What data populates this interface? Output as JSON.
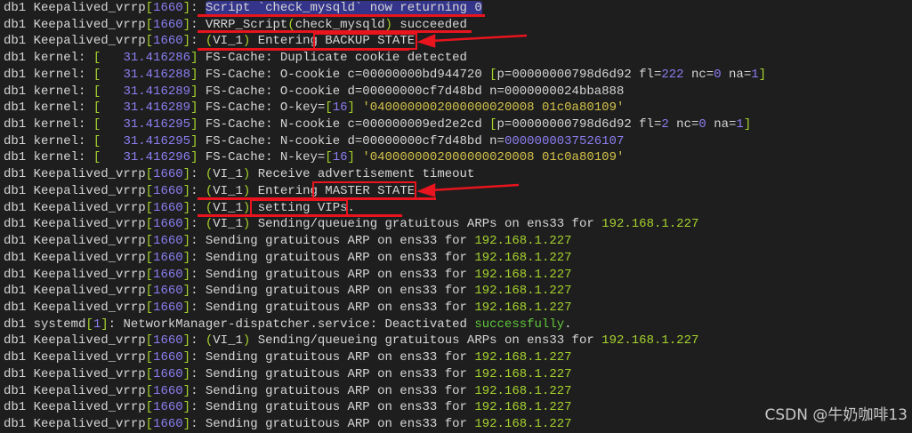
{
  "terminal": {
    "lines": [
      [
        [
          "db1 Keepalived_vrrp",
          "t"
        ],
        [
          "[",
          "g"
        ],
        [
          "1660",
          "p"
        ],
        [
          "]",
          "g"
        ],
        [
          ": ",
          "t"
        ],
        [
          "Script `check_mysqld` now returning 0",
          "sel"
        ]
      ],
      [
        [
          "db1 Keepalived_vrrp",
          "t"
        ],
        [
          "[",
          "g"
        ],
        [
          "1660",
          "p"
        ],
        [
          "]",
          "g"
        ],
        [
          ": VRRP_Script",
          "t"
        ],
        [
          "(",
          "g"
        ],
        [
          "check_mysqld",
          "t"
        ],
        [
          ")",
          "g"
        ],
        [
          " succeeded",
          "t"
        ]
      ],
      [
        [
          "db1 Keepalived_vrrp",
          "t"
        ],
        [
          "[",
          "g"
        ],
        [
          "1660",
          "p"
        ],
        [
          "]",
          "g"
        ],
        [
          ": ",
          "t"
        ],
        [
          "(",
          "g"
        ],
        [
          "VI_1",
          "t"
        ],
        [
          ")",
          "g"
        ],
        [
          " Entering BACKUP STATE",
          "t"
        ]
      ],
      [
        [
          "db1 kernel: ",
          "t"
        ],
        [
          "[",
          "g"
        ],
        [
          "   31.416286",
          "p"
        ],
        [
          "]",
          "g"
        ],
        [
          " FS-Cache: Duplicate cookie detected",
          "t"
        ]
      ],
      [
        [
          "db1 kernel: ",
          "t"
        ],
        [
          "[",
          "g"
        ],
        [
          "   31.416288",
          "p"
        ],
        [
          "]",
          "g"
        ],
        [
          " FS-Cache: O-cookie c=00000000bd944720 ",
          "t"
        ],
        [
          "[",
          "g"
        ],
        [
          "p=00000000798d6d92 fl=",
          "t"
        ],
        [
          "222",
          "p"
        ],
        [
          " nc=",
          "t"
        ],
        [
          "0",
          "p"
        ],
        [
          " na=",
          "t"
        ],
        [
          "1",
          "p"
        ],
        [
          "]",
          "g"
        ]
      ],
      [
        [
          "db1 kernel: ",
          "t"
        ],
        [
          "[",
          "g"
        ],
        [
          "   31.416289",
          "p"
        ],
        [
          "]",
          "g"
        ],
        [
          " FS-Cache: O-cookie d=00000000cf7d48bd n=0000000024bba888",
          "t"
        ]
      ],
      [
        [
          "db1 kernel: ",
          "t"
        ],
        [
          "[",
          "g"
        ],
        [
          "   31.416289",
          "p"
        ],
        [
          "]",
          "g"
        ],
        [
          " FS-Cache: O-key=",
          "t"
        ],
        [
          "[",
          "g"
        ],
        [
          "16",
          "p"
        ],
        [
          "]",
          "g"
        ],
        [
          " '0400000002000000020008 01c0a80109'",
          "y"
        ]
      ],
      [
        [
          "db1 kernel: ",
          "t"
        ],
        [
          "[",
          "g"
        ],
        [
          "   31.416295",
          "p"
        ],
        [
          "]",
          "g"
        ],
        [
          " FS-Cache: N-cookie c=000000009ed2e2cd ",
          "t"
        ],
        [
          "[",
          "g"
        ],
        [
          "p=00000000798d6d92 fl=",
          "t"
        ],
        [
          "2",
          "p"
        ],
        [
          " nc=",
          "t"
        ],
        [
          "0",
          "p"
        ],
        [
          " na=",
          "t"
        ],
        [
          "1",
          "p"
        ],
        [
          "]",
          "g"
        ]
      ],
      [
        [
          "db1 kernel: ",
          "t"
        ],
        [
          "[",
          "g"
        ],
        [
          "   31.416295",
          "p"
        ],
        [
          "]",
          "g"
        ],
        [
          " FS-Cache: N-cookie d=00000000cf7d48bd n=",
          "t"
        ],
        [
          "0000000037526107",
          "p"
        ]
      ],
      [
        [
          "db1 kernel: ",
          "t"
        ],
        [
          "[",
          "g"
        ],
        [
          "   31.416296",
          "p"
        ],
        [
          "]",
          "g"
        ],
        [
          " FS-Cache: N-key=",
          "t"
        ],
        [
          "[",
          "g"
        ],
        [
          "16",
          "p"
        ],
        [
          "]",
          "g"
        ],
        [
          " '0400000002000000020008 01c0a80109'",
          "y"
        ]
      ],
      [
        [
          "db1 Keepalived_vrrp",
          "t"
        ],
        [
          "[",
          "g"
        ],
        [
          "1660",
          "p"
        ],
        [
          "]",
          "g"
        ],
        [
          ": ",
          "t"
        ],
        [
          "(",
          "g"
        ],
        [
          "VI_1",
          "t"
        ],
        [
          ")",
          "g"
        ],
        [
          " Receive advertisement timeout",
          "t"
        ]
      ],
      [
        [
          "db1 Keepalived_vrrp",
          "t"
        ],
        [
          "[",
          "g"
        ],
        [
          "1660",
          "p"
        ],
        [
          "]",
          "g"
        ],
        [
          ": ",
          "t"
        ],
        [
          "(",
          "g"
        ],
        [
          "VI_1",
          "t"
        ],
        [
          ")",
          "g"
        ],
        [
          " Entering MASTER STATE",
          "t"
        ]
      ],
      [
        [
          "db1 Keepalived_vrrp",
          "t"
        ],
        [
          "[",
          "g"
        ],
        [
          "1660",
          "p"
        ],
        [
          "]",
          "g"
        ],
        [
          ": ",
          "t"
        ],
        [
          "(",
          "g"
        ],
        [
          "VI_1",
          "t"
        ],
        [
          ")",
          "g"
        ],
        [
          " setting VIPs.",
          "t"
        ]
      ],
      [
        [
          "db1 Keepalived_vrrp",
          "t"
        ],
        [
          "[",
          "g"
        ],
        [
          "1660",
          "p"
        ],
        [
          "]",
          "g"
        ],
        [
          ": ",
          "t"
        ],
        [
          "(",
          "g"
        ],
        [
          "VI_1",
          "t"
        ],
        [
          ")",
          "g"
        ],
        [
          " Sending/queueing gratuitous ARPs on ens33 for ",
          "t"
        ],
        [
          "192.168.1.227",
          "ip"
        ]
      ],
      [
        [
          "db1 Keepalived_vrrp",
          "t"
        ],
        [
          "[",
          "g"
        ],
        [
          "1660",
          "p"
        ],
        [
          "]",
          "g"
        ],
        [
          ": Sending gratuitous ARP on ens33 for ",
          "t"
        ],
        [
          "192.168.1.227",
          "ip"
        ]
      ],
      [
        [
          "db1 Keepalived_vrrp",
          "t"
        ],
        [
          "[",
          "g"
        ],
        [
          "1660",
          "p"
        ],
        [
          "]",
          "g"
        ],
        [
          ": Sending gratuitous ARP on ens33 for ",
          "t"
        ],
        [
          "192.168.1.227",
          "ip"
        ]
      ],
      [
        [
          "db1 Keepalived_vrrp",
          "t"
        ],
        [
          "[",
          "g"
        ],
        [
          "1660",
          "p"
        ],
        [
          "]",
          "g"
        ],
        [
          ": Sending gratuitous ARP on ens33 for ",
          "t"
        ],
        [
          "192.168.1.227",
          "ip"
        ]
      ],
      [
        [
          "db1 Keepalived_vrrp",
          "t"
        ],
        [
          "[",
          "g"
        ],
        [
          "1660",
          "p"
        ],
        [
          "]",
          "g"
        ],
        [
          ": Sending gratuitous ARP on ens33 for ",
          "t"
        ],
        [
          "192.168.1.227",
          "ip"
        ]
      ],
      [
        [
          "db1 Keepalived_vrrp",
          "t"
        ],
        [
          "[",
          "g"
        ],
        [
          "1660",
          "p"
        ],
        [
          "]",
          "g"
        ],
        [
          ": Sending gratuitous ARP on ens33 for ",
          "t"
        ],
        [
          "192.168.1.227",
          "ip"
        ]
      ],
      [
        [
          "db1 systemd",
          "t"
        ],
        [
          "[",
          "g"
        ],
        [
          "1",
          "p"
        ],
        [
          "]",
          "g"
        ],
        [
          ": NetworkManager-dispatcher.service: Deactivated ",
          "t"
        ],
        [
          "successfully",
          "ok"
        ],
        [
          ".",
          "t"
        ]
      ],
      [
        [
          "db1 Keepalived_vrrp",
          "t"
        ],
        [
          "[",
          "g"
        ],
        [
          "1660",
          "p"
        ],
        [
          "]",
          "g"
        ],
        [
          ": ",
          "t"
        ],
        [
          "(",
          "g"
        ],
        [
          "VI_1",
          "t"
        ],
        [
          ")",
          "g"
        ],
        [
          " Sending/queueing gratuitous ARPs on ens33 for ",
          "t"
        ],
        [
          "192.168.1.227",
          "ip"
        ]
      ],
      [
        [
          "db1 Keepalived_vrrp",
          "t"
        ],
        [
          "[",
          "g"
        ],
        [
          "1660",
          "p"
        ],
        [
          "]",
          "g"
        ],
        [
          ": Sending gratuitous ARP on ens33 for ",
          "t"
        ],
        [
          "192.168.1.227",
          "ip"
        ]
      ],
      [
        [
          "db1 Keepalived_vrrp",
          "t"
        ],
        [
          "[",
          "g"
        ],
        [
          "1660",
          "p"
        ],
        [
          "]",
          "g"
        ],
        [
          ": Sending gratuitous ARP on ens33 for ",
          "t"
        ],
        [
          "192.168.1.227",
          "ip"
        ]
      ],
      [
        [
          "db1 Keepalived_vrrp",
          "t"
        ],
        [
          "[",
          "g"
        ],
        [
          "1660",
          "p"
        ],
        [
          "]",
          "g"
        ],
        [
          ": Sending gratuitous ARP on ens33 for ",
          "t"
        ],
        [
          "192.168.1.227",
          "ip"
        ]
      ],
      [
        [
          "db1 Keepalived_vrrp",
          "t"
        ],
        [
          "[",
          "g"
        ],
        [
          "1660",
          "p"
        ],
        [
          "]",
          "g"
        ],
        [
          ": Sending gratuitous ARP on ens33 for ",
          "t"
        ],
        [
          "192.168.1.227",
          "ip"
        ]
      ],
      [
        [
          "db1 Keepalived_vrrp",
          "t"
        ],
        [
          "[",
          "g"
        ],
        [
          "1660",
          "p"
        ],
        [
          "]",
          "g"
        ],
        [
          ": Sending gratuitous ARP on ens33 for ",
          "t"
        ],
        [
          "192.168.1.227",
          "ip"
        ]
      ]
    ]
  },
  "watermark": "CSDN @牛奶咖啡13",
  "colors": {
    "background": "#1e1e1e",
    "annotation": "#e8141e",
    "selection": "#34348a"
  }
}
